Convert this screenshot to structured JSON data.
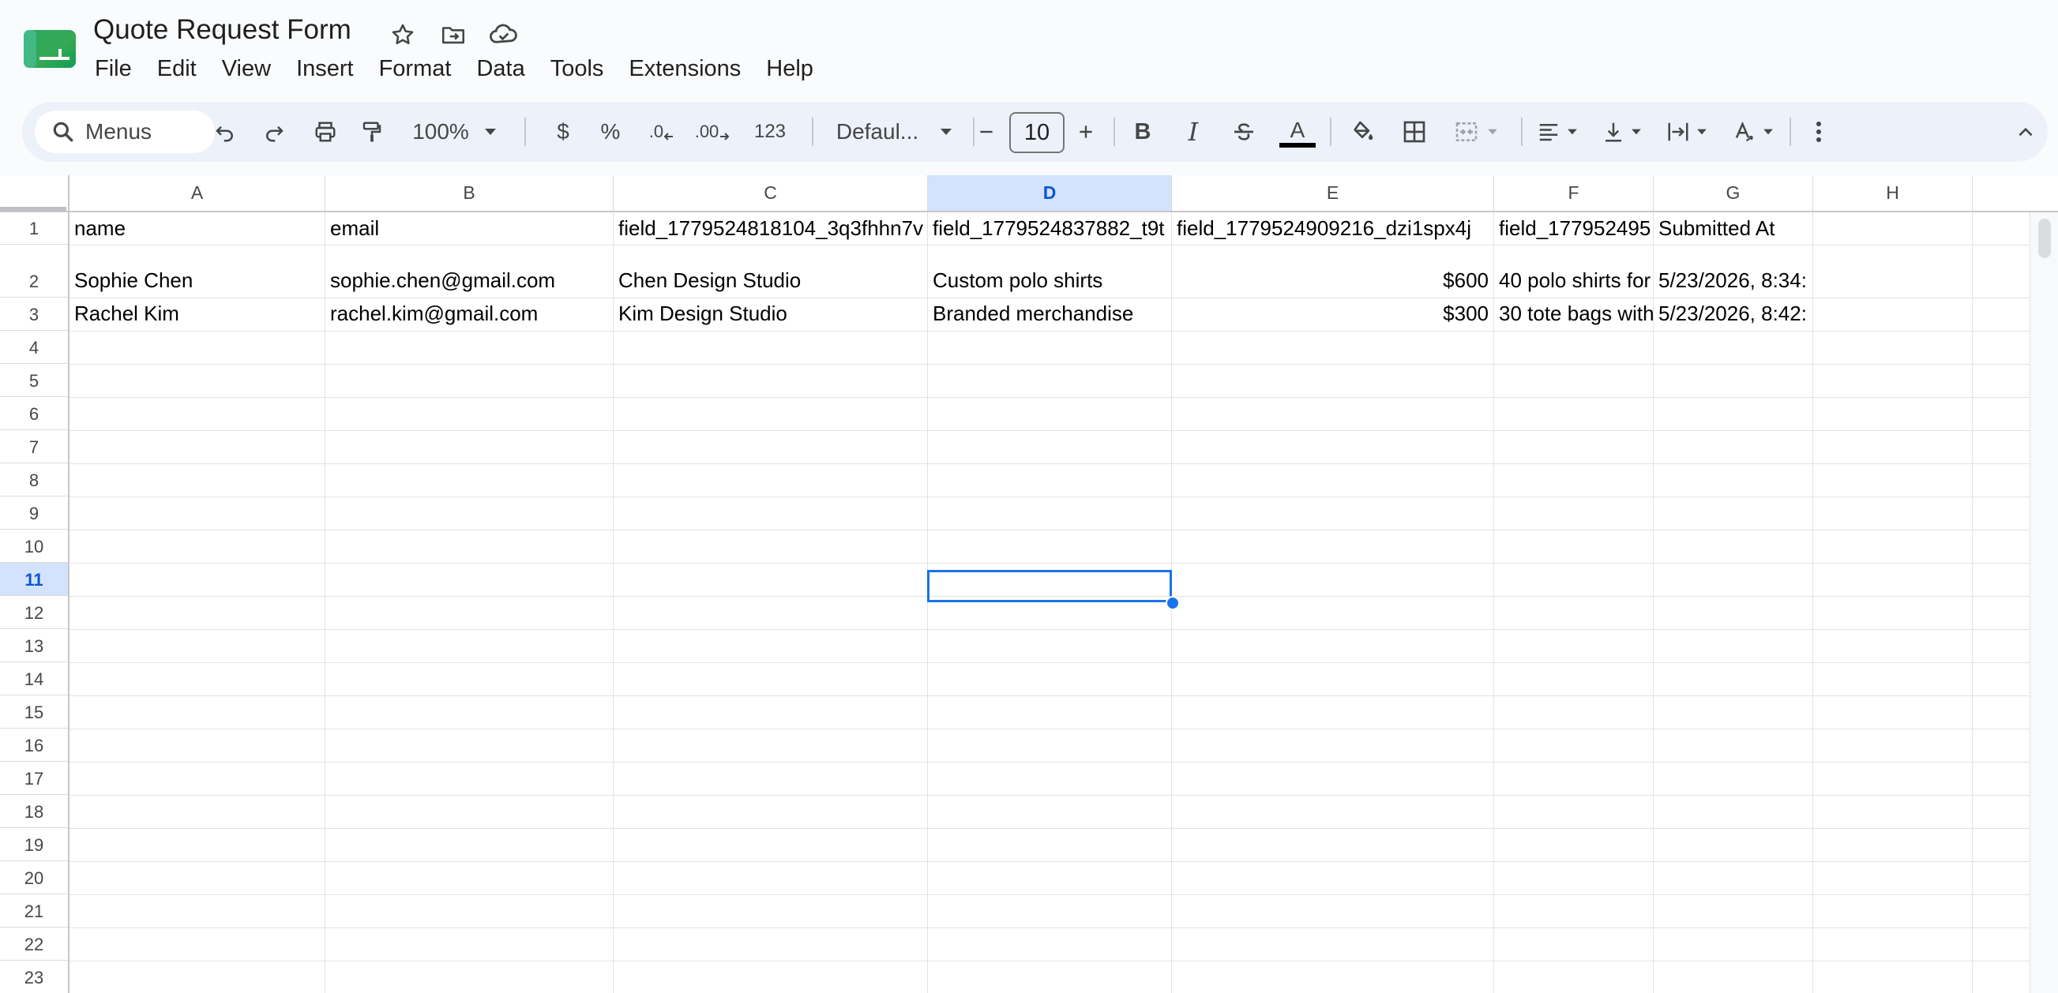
{
  "app": {
    "title": "Quote Request Form",
    "icons": [
      "sheets-logo-icon",
      "star-icon",
      "move-folder-icon",
      "cloud-saved-icon"
    ]
  },
  "menu": [
    "File",
    "Edit",
    "View",
    "Insert",
    "Format",
    "Data",
    "Tools",
    "Extensions",
    "Help"
  ],
  "toolbar": {
    "search_label": "Menus",
    "zoom": "100%",
    "currency": "$",
    "percent": "%",
    "decrease_decimal": ".0",
    "increase_decimal": ".00",
    "number_format": "123",
    "font": "Defaul...",
    "font_size": "10",
    "bold": "B",
    "italic": "I",
    "text_color_letter": "A",
    "text_color": "#000000",
    "accent": "#0b57d0"
  },
  "sheet": {
    "columns": [
      "A",
      "B",
      "C",
      "D",
      "E",
      "F",
      "G",
      "H"
    ],
    "selected_column": "D",
    "selected_row": 11,
    "active_cell": "D11",
    "rows": [
      "1",
      "2",
      "3",
      "4",
      "5",
      "6",
      "7",
      "8",
      "9",
      "10",
      "11",
      "12",
      "13",
      "14",
      "15",
      "16",
      "17",
      "18",
      "19",
      "20",
      "21",
      "22",
      "23"
    ],
    "header_row": [
      "name",
      "email",
      "field_1779524818104_3q3fhhn7v",
      "field_1779524837882_t9t",
      "field_1779524909216_dzi1spx4j",
      "field_177952495",
      "Submitted At"
    ],
    "data": [
      [
        "Sophie Chen",
        "sophie.chen@gmail.com",
        "Chen Design Studio",
        "Custom polo shirts",
        "$600",
        "40 polo shirts for",
        "5/23/2026, 8:34:"
      ],
      [
        "Rachel Kim",
        "rachel.kim@gmail.com",
        "Kim Design Studio",
        "Branded merchandise",
        "$300",
        "30 tote bags with",
        "5/23/2026, 8:42:"
      ]
    ]
  }
}
